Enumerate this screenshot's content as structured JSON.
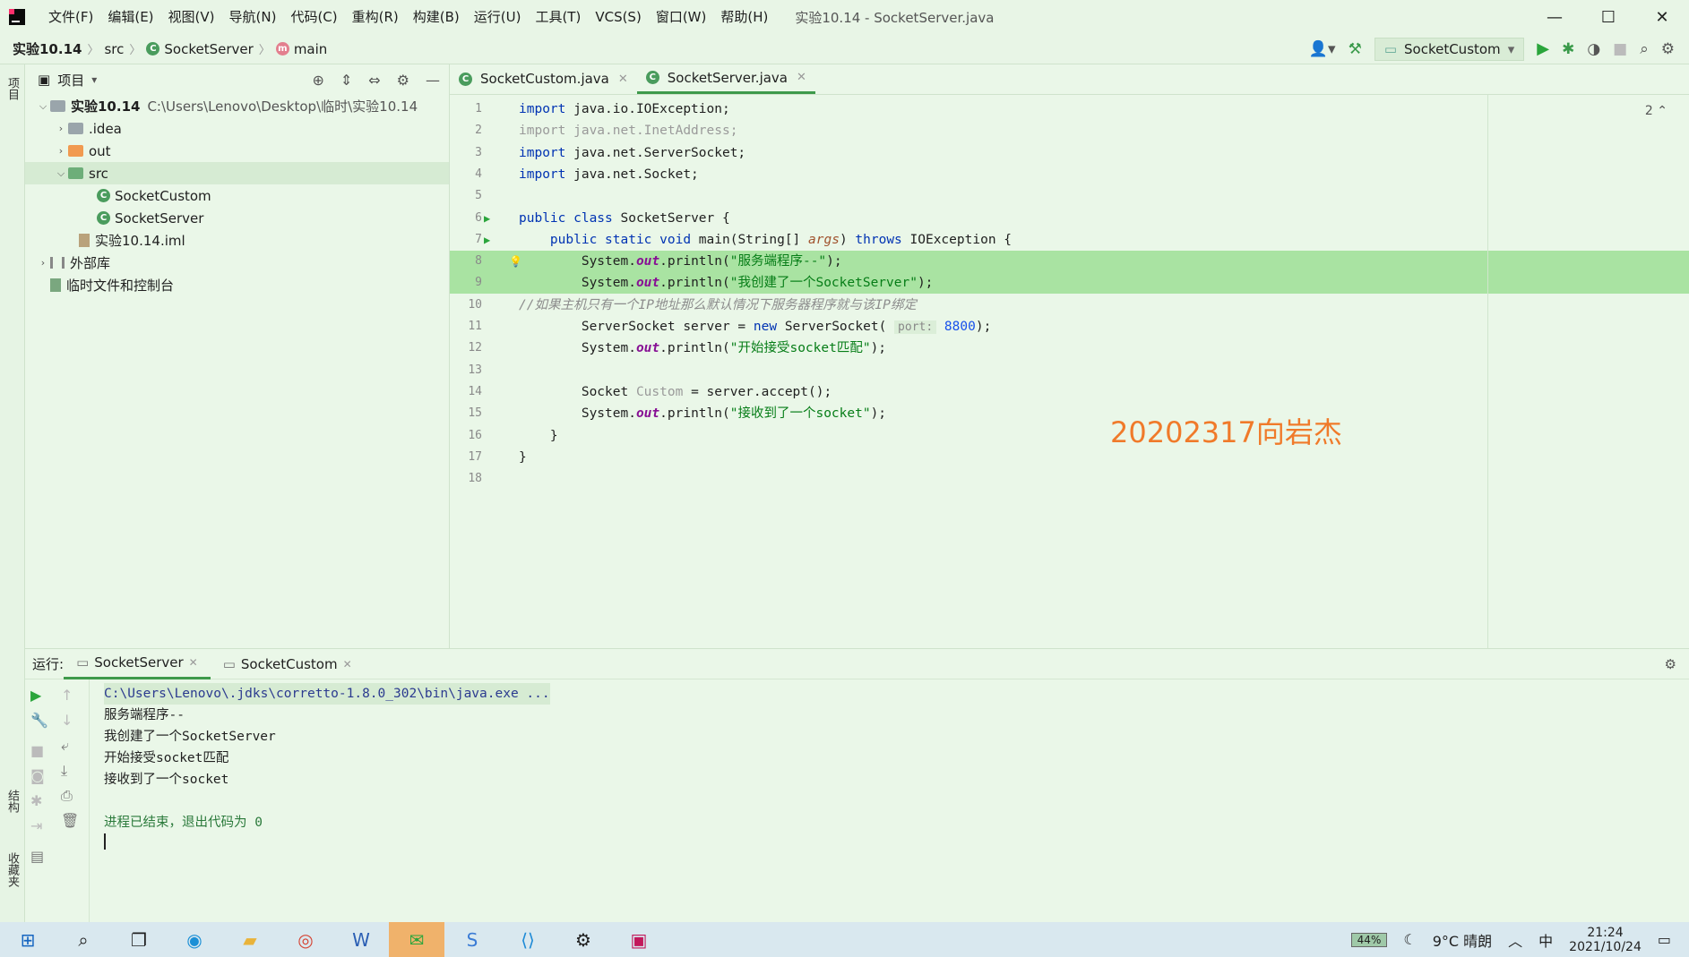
{
  "window": {
    "title": "实验10.14 - SocketServer.java",
    "menu": [
      "文件(F)",
      "编辑(E)",
      "视图(V)",
      "导航(N)",
      "代码(C)",
      "重构(R)",
      "构建(B)",
      "运行(U)",
      "工具(T)",
      "VCS(S)",
      "窗口(W)",
      "帮助(H)"
    ],
    "controls": {
      "minimize": "—",
      "maximize": "☐",
      "close": "✕"
    }
  },
  "navbar": {
    "crumbs": [
      "实验10.14",
      "src",
      "SocketServer",
      "main"
    ],
    "run_config": "SocketCustom"
  },
  "left_strip": {
    "top_tab": "项目",
    "bottom_tabs": [
      "结构",
      "收藏夹"
    ]
  },
  "project": {
    "header": "项目",
    "tree": [
      {
        "name": "实验10.14",
        "hint": "C:\\Users\\Lenovo\\Desktop\\临时\\实验10.14"
      },
      {
        "name": ".idea"
      },
      {
        "name": "out"
      },
      {
        "name": "src"
      },
      {
        "name": "SocketCustom"
      },
      {
        "name": "SocketServer"
      },
      {
        "name": "实验10.14.iml"
      },
      {
        "name": "外部库"
      },
      {
        "name": "临时文件和控制台"
      }
    ]
  },
  "editor": {
    "tabs": [
      "SocketCustom.java",
      "SocketServer.java"
    ],
    "active_tab": "SocketServer.java",
    "warnings": "2",
    "watermark": "20202317向岩杰",
    "lines": [
      {
        "n": "1",
        "parts": [
          [
            "kw",
            "import "
          ],
          [
            "",
            "java.io.IOException;"
          ]
        ]
      },
      {
        "n": "2",
        "parts": [
          [
            "grey",
            "import java.net.InetAddress;"
          ]
        ]
      },
      {
        "n": "3",
        "parts": [
          [
            "kw",
            "import "
          ],
          [
            "",
            "java.net.ServerSocket;"
          ]
        ]
      },
      {
        "n": "4",
        "parts": [
          [
            "kw",
            "import "
          ],
          [
            "",
            "java.net.Socket;"
          ]
        ]
      },
      {
        "n": "5",
        "parts": []
      },
      {
        "n": "6",
        "parts": [
          [
            "kw",
            "public class "
          ],
          [
            "",
            "SocketServer {"
          ]
        ]
      },
      {
        "n": "7",
        "parts": [
          [
            "kw",
            "    public static void "
          ],
          [
            "",
            "main(String[] "
          ],
          [
            "it-brown",
            "args"
          ],
          [
            "",
            ") "
          ],
          [
            "kw",
            "throws "
          ],
          [
            "",
            "IOException {"
          ]
        ]
      },
      {
        "n": "8",
        "parts": [
          [
            "",
            "        System."
          ],
          [
            "field-b",
            "out"
          ],
          [
            "",
            ".println("
          ],
          [
            "str",
            "\"服务端程序--\""
          ],
          [
            "",
            ");"
          ]
        ]
      },
      {
        "n": "9",
        "parts": [
          [
            "",
            "        System."
          ],
          [
            "field-b",
            "out"
          ],
          [
            "",
            ".println("
          ],
          [
            "str",
            "\"我创建了一个SocketServer\""
          ],
          [
            "",
            ");"
          ]
        ]
      },
      {
        "n": "10",
        "parts": [
          [
            "cmt",
            "//如果主机只有一个IP地址那么默认情况下服务器程序就与该IP绑定"
          ]
        ]
      },
      {
        "n": "11",
        "parts": [
          [
            "",
            "        ServerSocket server = "
          ],
          [
            "kw",
            "new "
          ],
          [
            "",
            "ServerSocket( "
          ],
          [
            "hint",
            "port:"
          ],
          [
            "num",
            " 8800"
          ],
          [
            "",
            ");"
          ]
        ]
      },
      {
        "n": "12",
        "parts": [
          [
            "",
            "        System."
          ],
          [
            "field-b",
            "out"
          ],
          [
            "",
            ".println("
          ],
          [
            "str",
            "\"开始接受socket匹配\""
          ],
          [
            "",
            ");"
          ]
        ]
      },
      {
        "n": "13",
        "parts": []
      },
      {
        "n": "14",
        "parts": [
          [
            "",
            "        Socket "
          ],
          [
            "grey",
            "Custom"
          ],
          [
            "",
            " = server.accept();"
          ]
        ]
      },
      {
        "n": "15",
        "parts": [
          [
            "",
            "        System."
          ],
          [
            "field-b",
            "out"
          ],
          [
            "",
            ".println("
          ],
          [
            "str",
            "\"接收到了一个socket\""
          ],
          [
            "",
            ");"
          ]
        ]
      },
      {
        "n": "16",
        "parts": [
          [
            "",
            "    }"
          ]
        ]
      },
      {
        "n": "17",
        "parts": [
          [
            "",
            "}"
          ]
        ]
      },
      {
        "n": "18",
        "parts": []
      }
    ]
  },
  "run": {
    "label": "运行:",
    "tabs": [
      "SocketServer",
      "SocketCustom"
    ],
    "console": [
      "C:\\Users\\Lenovo\\.jdks\\corretto-1.8.0_302\\bin\\java.exe ...",
      "服务端程序--",
      "我创建了一个SocketServer",
      "开始接受socket匹配",
      "接收到了一个socket",
      "",
      "进程已结束，退出代码为 0"
    ]
  },
  "taskbar": {
    "battery": "44%",
    "weather": "9°C 晴朗",
    "ime": "中",
    "time": "21:24",
    "date": "2021/10/24"
  }
}
